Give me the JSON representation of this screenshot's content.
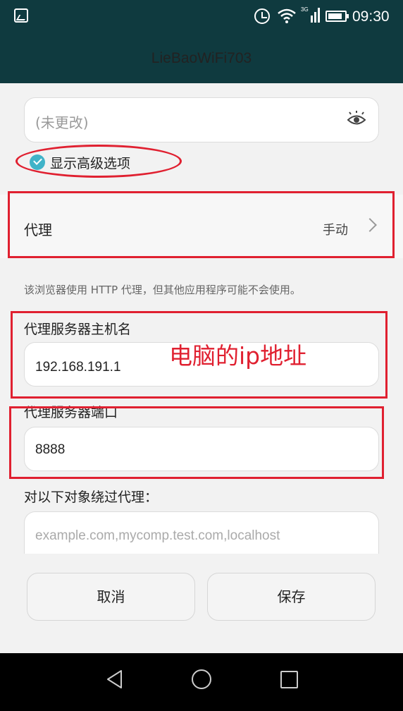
{
  "status_bar": {
    "time": "09:30",
    "icons": [
      "gallery-icon",
      "alarm-icon",
      "wifi-icon",
      "signal-3g-icon",
      "battery-icon"
    ]
  },
  "header": {
    "title": "LieBaoWiFi703"
  },
  "password": {
    "placeholder": "(未更改)"
  },
  "advanced": {
    "label": "显示高级选项",
    "checked": true
  },
  "proxy": {
    "label": "代理",
    "mode": "手动"
  },
  "note": "该浏览器使用 HTTP 代理，但其他应用程序可能不会使用。",
  "host": {
    "label": "代理服务器主机名",
    "value": "192.168.191.1",
    "annotation": "电脑的ip地址"
  },
  "port": {
    "label": "代理服务器端口",
    "value": "8888"
  },
  "bypass": {
    "label": "对以下对象绕过代理：",
    "placeholder": "example.com,mycomp.test.com,localhost"
  },
  "buttons": {
    "cancel": "取消",
    "save": "保存"
  },
  "nav": [
    "back-icon",
    "home-icon",
    "recent-apps-icon"
  ],
  "colors": {
    "header_bg": "#0f3a3f",
    "accent": "#40b3c8",
    "annotation_red": "#e02030"
  }
}
